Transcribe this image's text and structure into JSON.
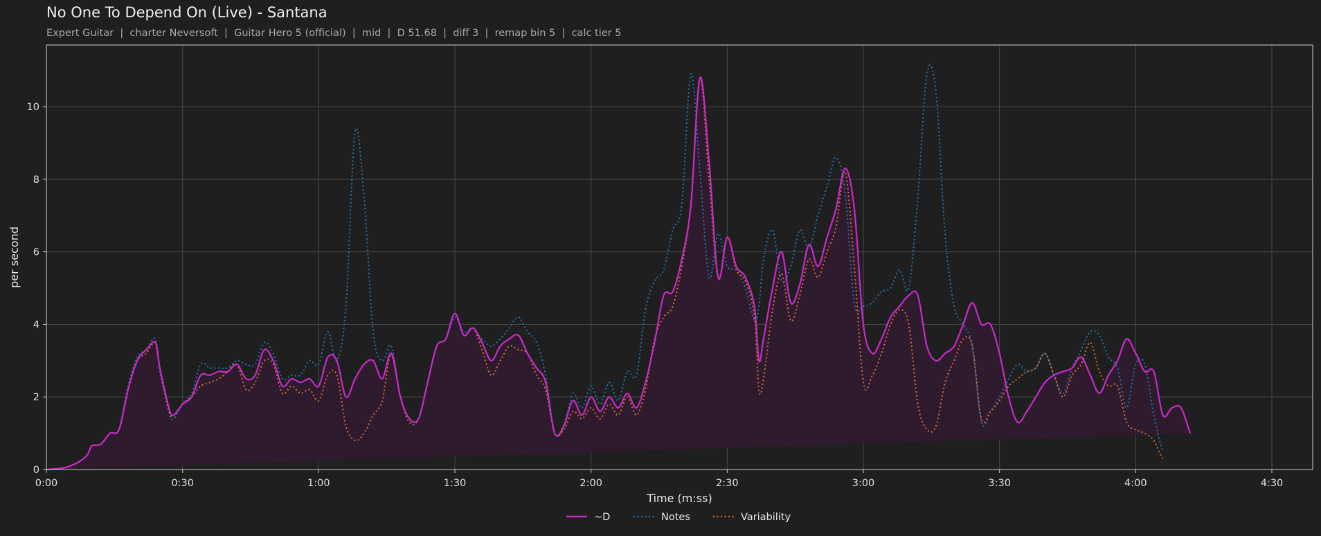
{
  "header": {
    "title": "No One To Depend On (Live) - Santana",
    "subtitle": "Expert Guitar  |  charter Neversoft  |  Guitar Hero 5 (official)  |  mid  |  D 51.68  |  diff 3  |  remap bin 5  |  calc tier 5"
  },
  "colors": {
    "background": "#1f1f1f",
    "d": "#c82bc8",
    "notes": "#1f77b4",
    "variability": "#e0702b",
    "fill": "#2e1b2e",
    "grid": "#4a4a4a"
  },
  "chart_data": {
    "type": "line",
    "title": "No One To Depend On (Live) - Santana",
    "xlabel": "Time (m:ss)",
    "ylabel": "per second",
    "xlim": [
      0,
      279
    ],
    "ylim": [
      0,
      11.7
    ],
    "grid": true,
    "legend_placement": "bottom-center",
    "x_ticks": [
      {
        "v": 0,
        "label": "0:00"
      },
      {
        "v": 30,
        "label": "0:30"
      },
      {
        "v": 60,
        "label": "1:00"
      },
      {
        "v": 90,
        "label": "1:30"
      },
      {
        "v": 120,
        "label": "2:00"
      },
      {
        "v": 150,
        "label": "2:30"
      },
      {
        "v": 180,
        "label": "3:00"
      },
      {
        "v": 210,
        "label": "3:30"
      },
      {
        "v": 240,
        "label": "4:00"
      },
      {
        "v": 270,
        "label": "4:30"
      }
    ],
    "y_ticks": [
      {
        "v": 0,
        "label": "0"
      },
      {
        "v": 2,
        "label": "2"
      },
      {
        "v": 4,
        "label": "4"
      },
      {
        "v": 6,
        "label": "6"
      },
      {
        "v": 8,
        "label": "8"
      },
      {
        "v": 10,
        "label": "10"
      }
    ],
    "x": [
      0,
      4,
      7,
      9,
      10,
      12,
      14,
      16,
      18,
      20,
      22,
      24,
      25,
      27,
      28,
      30,
      32,
      34,
      36,
      38,
      40,
      42,
      44,
      46,
      48,
      50,
      52,
      54,
      56,
      58,
      60,
      62,
      64,
      66,
      68,
      70,
      72,
      74,
      76,
      78,
      80,
      82,
      84,
      86,
      88,
      90,
      92,
      94,
      96,
      98,
      100,
      102,
      104,
      106,
      108,
      110,
      112,
      114,
      116,
      118,
      120,
      122,
      124,
      126,
      128,
      130,
      132,
      134,
      136,
      138,
      140,
      142,
      144,
      146,
      148,
      150,
      152,
      154,
      156,
      157,
      158,
      160,
      162,
      164,
      166,
      168,
      170,
      172,
      174,
      176,
      178,
      180,
      182,
      184,
      186,
      188,
      190,
      192,
      194,
      196,
      198,
      200,
      202,
      204,
      206,
      208,
      210,
      212,
      214,
      216,
      218,
      220,
      222,
      224,
      226,
      228,
      230,
      232,
      234,
      236,
      238,
      240,
      242,
      244,
      246,
      248,
      250,
      252,
      254,
      256,
      258,
      260,
      262,
      264,
      266,
      268,
      270,
      272,
      274,
      276,
      278,
      279
    ],
    "series": [
      {
        "name": "~D",
        "values": [
          0,
          0.05,
          0.2,
          0.4,
          0.65,
          0.7,
          1.0,
          1.1,
          2.2,
          3.0,
          3.3,
          3.5,
          2.8,
          1.7,
          1.5,
          1.8,
          2.0,
          2.6,
          2.6,
          2.7,
          2.7,
          2.9,
          2.5,
          2.6,
          3.3,
          3.0,
          2.3,
          2.5,
          2.4,
          2.5,
          2.3,
          3.1,
          3.0,
          2.0,
          2.5,
          2.9,
          3.0,
          2.5,
          3.2,
          2.0,
          1.4,
          1.4,
          2.4,
          3.4,
          3.6,
          4.3,
          3.7,
          3.9,
          3.5,
          3.0,
          3.4,
          3.6,
          3.7,
          3.2,
          2.8,
          2.4,
          1.0,
          1.2,
          1.9,
          1.5,
          2.0,
          1.6,
          2.0,
          1.7,
          2.1,
          1.7,
          2.4,
          3.5,
          4.8,
          4.9,
          5.8,
          7.3,
          10.8,
          8.5,
          5.3,
          6.4,
          5.6,
          5.3,
          4.5,
          3.0,
          3.6,
          5.0,
          6.0,
          4.6,
          5.1,
          6.2,
          5.6,
          6.4,
          7.2,
          8.3,
          7.2,
          4.0,
          3.2,
          3.6,
          4.2,
          4.5,
          4.8,
          4.8,
          3.4,
          3.0,
          3.2,
          3.4,
          4.0,
          4.6,
          4.0,
          4.0,
          3.2,
          2.0,
          1.3,
          1.6,
          2.0,
          2.4,
          2.6,
          2.7,
          2.8,
          3.1,
          2.6,
          2.1,
          2.6,
          3.0,
          3.6,
          3.2,
          2.7,
          2.7,
          1.5,
          1.7,
          1.7,
          1.0,
          0.3
        ]
      },
      {
        "name": "Notes",
        "values": [
          0,
          0.05,
          0.2,
          0.4,
          0.65,
          0.7,
          1.0,
          1.1,
          2.3,
          3.1,
          3.3,
          3.6,
          2.7,
          1.6,
          1.4,
          1.8,
          2.1,
          2.9,
          2.8,
          2.8,
          2.8,
          3.0,
          2.9,
          2.9,
          3.5,
          3.2,
          2.5,
          2.6,
          2.6,
          3.0,
          2.9,
          3.8,
          3.0,
          4.5,
          9.3,
          7.5,
          3.8,
          3.0,
          3.4,
          2.0,
          1.4,
          1.4,
          2.4,
          3.4,
          3.6,
          4.2,
          3.8,
          3.9,
          3.6,
          3.4,
          3.6,
          3.9,
          4.2,
          3.8,
          3.5,
          2.6,
          1.0,
          1.2,
          2.1,
          1.7,
          2.3,
          1.8,
          2.4,
          1.9,
          2.7,
          2.6,
          4.4,
          5.2,
          5.5,
          6.6,
          7.3,
          10.9,
          8.2,
          5.3,
          6.5,
          5.6,
          5.5,
          5.0,
          4.1,
          4.5,
          5.8,
          6.6,
          5.2,
          5.6,
          6.6,
          6.1,
          7.0,
          7.8,
          8.6,
          7.6,
          4.6,
          4.5,
          4.6,
          4.9,
          5.0,
          5.5,
          5.0,
          7.5,
          10.9,
          10.4,
          6.5,
          4.5,
          4.0,
          3.4,
          1.3,
          1.6,
          2.0,
          2.5,
          2.9,
          2.7,
          2.8,
          3.2,
          2.6,
          2.1,
          2.8,
          3.3,
          3.8,
          3.7,
          3.1,
          2.8,
          1.7,
          2.9,
          2.9,
          1.5,
          0.5,
          0.2
        ]
      },
      {
        "name": "Variability",
        "values": [
          0,
          0.05,
          0.2,
          0.4,
          0.65,
          0.7,
          1.0,
          1.1,
          2.2,
          3.0,
          3.2,
          3.5,
          2.8,
          1.6,
          1.5,
          1.8,
          2.0,
          2.3,
          2.4,
          2.5,
          2.7,
          2.9,
          2.2,
          2.4,
          3.0,
          2.9,
          2.1,
          2.3,
          2.1,
          2.2,
          1.9,
          2.6,
          2.6,
          1.2,
          0.8,
          1.0,
          1.5,
          1.9,
          3.2,
          2.0,
          1.3,
          1.4,
          2.4,
          3.4,
          3.6,
          4.3,
          3.7,
          3.9,
          3.3,
          2.6,
          3.0,
          3.4,
          3.3,
          3.2,
          2.6,
          2.2,
          1.0,
          1.1,
          1.6,
          1.4,
          1.7,
          1.4,
          1.8,
          1.5,
          2.0,
          1.5,
          2.2,
          3.6,
          4.2,
          4.5,
          5.6,
          7.3,
          10.8,
          8.0,
          5.3,
          6.4,
          5.5,
          5.2,
          4.2,
          2.2,
          2.5,
          4.4,
          5.4,
          4.1,
          4.8,
          5.8,
          5.3,
          6.0,
          6.7,
          8.2,
          5.6,
          2.4,
          2.6,
          3.2,
          4.0,
          4.4,
          4.0,
          1.8,
          1.1,
          1.2,
          2.4,
          3.0,
          3.6,
          3.4,
          1.4,
          1.6,
          1.9,
          2.3,
          2.5,
          2.7,
          2.8,
          3.2,
          2.6,
          2.0,
          2.6,
          2.9,
          3.5,
          2.7,
          2.3,
          2.3,
          1.3,
          1.1,
          1.0,
          0.8,
          0.3,
          0.2
        ]
      }
    ]
  }
}
